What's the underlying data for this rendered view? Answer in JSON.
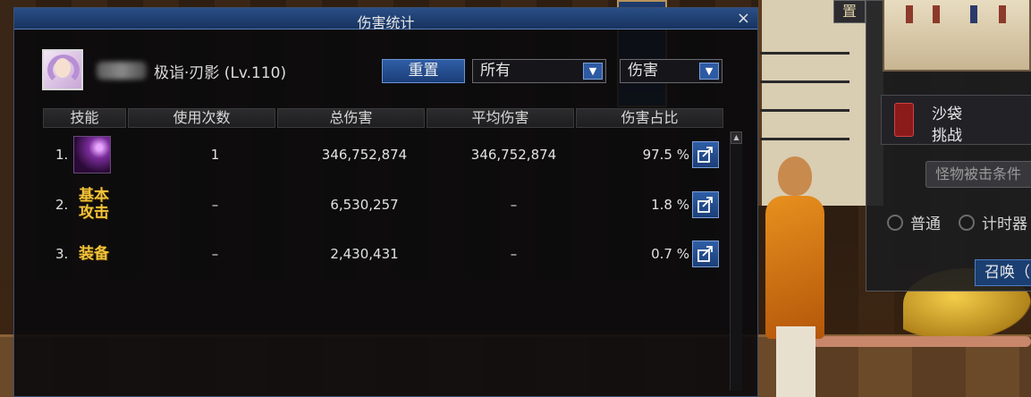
{
  "dialog": {
    "title": "伤害统计",
    "close": "×",
    "character_name": "极诣·刃影 (Lv.110)",
    "reset_label": "重置",
    "filter_select": "所有",
    "metric_select": "伤害",
    "dropdown_arrow": "▼",
    "columns": [
      "技能",
      "使用次数",
      "总伤害",
      "平均伤害",
      "伤害占比"
    ],
    "rows": [
      {
        "rank": "1.",
        "skill_label": "",
        "icon": "skill-icon",
        "uses": "1",
        "total": "346,752,874",
        "avg": "346,752,874",
        "pct": "97.5 %"
      },
      {
        "rank": "2.",
        "skill_label": "基本\n攻击",
        "icon": "",
        "uses": "–",
        "total": "6,530,257",
        "avg": "–",
        "pct": "1.8 %"
      },
      {
        "rank": "3.",
        "skill_label": "装备",
        "icon": "",
        "uses": "–",
        "total": "2,430,431",
        "avg": "–",
        "pct": "0.7 %"
      }
    ],
    "scroll_up": "▲"
  },
  "right_panel": {
    "tab_label": "置",
    "target_name": "沙袋",
    "target_sub": "挑战",
    "monster_button": "怪物被击条件",
    "radio_normal": "普通",
    "radio_timed": "计时器",
    "summon_button": "召唤（"
  },
  "colors": {
    "title_bar": "#2a4e86",
    "skill_text_gold": "#f2c33a",
    "button_blue": "#2f5ea6"
  }
}
